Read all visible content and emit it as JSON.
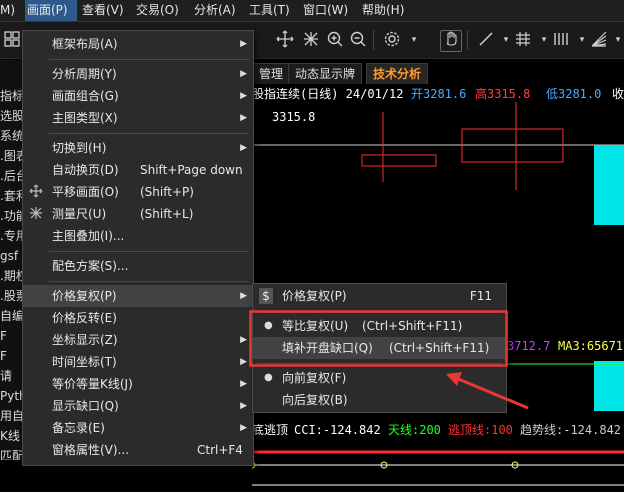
{
  "menubar": {
    "items": [
      {
        "label": "M)",
        "active": false
      },
      {
        "label": "画面(P)",
        "active": true
      },
      {
        "label": "查看(V)",
        "active": false
      },
      {
        "label": "交易(O)",
        "active": false
      },
      {
        "label": "分析(A)",
        "active": false
      },
      {
        "label": "工具(T)",
        "active": false
      },
      {
        "label": "窗口(W)",
        "active": false
      },
      {
        "label": "帮助(H)",
        "active": false
      }
    ]
  },
  "toolbar": {
    "icons": [
      "grid-icon",
      "move-icon",
      "crosshair-icon",
      "zoom-in-icon",
      "zoom-out-icon",
      "settings-icon",
      "hand-icon",
      "line-icon",
      "grid-draw-icon",
      "bars-icon",
      "fan-icon"
    ]
  },
  "left_panel": {
    "items": [
      "指标",
      "选股",
      "系统",
      ".图表",
      ".后台",
      ".套利",
      ".功能",
      ".专用",
      "gsf",
      ".期权",
      ".股票",
      "自编",
      "F",
      "F",
      "请",
      "Pyth",
      "用自",
      "K线",
      "匹配"
    ]
  },
  "tabs": [
    {
      "label": "管理",
      "active": false
    },
    {
      "label": "动态显示牌",
      "active": false
    },
    {
      "label": "技术分析",
      "active": true
    }
  ],
  "chart": {
    "header_title": "股指连续(日线) 24/01/12",
    "open_label": "开3281.6",
    "high_label": "高3315.8",
    "low_label": "低3281.0",
    "tail_label": "收",
    "price_label": "3315.8",
    "ma_left": "3712.7",
    "ma3_label": "MA3:65671",
    "indicator_prefix": "底逃顶",
    "cci_label": "CCI:-124.842",
    "sky_label": "天线:200",
    "escape_label": "逃顶线:100",
    "trend_label": "趋势线:-124.842",
    "colors": {
      "open": "#4aa8ff",
      "high": "#ff4040",
      "low": "#4aa8ff",
      "cyan_candle": "#00e5e5",
      "red_candle": "#ff2a2a",
      "indicator_white": "#ffffff",
      "indicator_green": "#22ff22",
      "indicator_red": "#ff3030"
    }
  },
  "main_menu": {
    "items": [
      {
        "label": "框架布局(A)",
        "shortcut": "",
        "submenu": true,
        "icon": ""
      },
      {
        "label": "分析周期(Y)",
        "shortcut": "",
        "submenu": true,
        "icon": ""
      },
      {
        "label": "画面组合(G)",
        "shortcut": "",
        "submenu": true,
        "icon": ""
      },
      {
        "label": "主图类型(X)",
        "shortcut": "",
        "submenu": true,
        "icon": ""
      },
      {
        "label": "切换到(H)",
        "shortcut": "",
        "submenu": true,
        "icon": ""
      },
      {
        "label": "自动换页(D)",
        "shortcut": "Shift+Page down",
        "submenu": false,
        "icon": ""
      },
      {
        "label": "平移画面(O)",
        "shortcut": "(Shift+P)",
        "submenu": false,
        "icon": "move-icon"
      },
      {
        "label": "测量尺(U)",
        "shortcut": "(Shift+L)",
        "submenu": false,
        "icon": "ruler-icon"
      },
      {
        "label": "主图叠加(I)...",
        "shortcut": "",
        "submenu": false,
        "icon": ""
      },
      {
        "label": "配色方案(S)...",
        "shortcut": "",
        "submenu": false,
        "icon": ""
      },
      {
        "label": "价格复权(P)",
        "shortcut": "",
        "submenu": true,
        "icon": ""
      },
      {
        "label": "价格反转(E)",
        "shortcut": "",
        "submenu": false,
        "icon": ""
      },
      {
        "label": "坐标显示(Z)",
        "shortcut": "",
        "submenu": true,
        "icon": ""
      },
      {
        "label": "时间坐标(T)",
        "shortcut": "",
        "submenu": true,
        "icon": ""
      },
      {
        "label": "等价等量K线(J)",
        "shortcut": "",
        "submenu": true,
        "icon": ""
      },
      {
        "label": "显示缺口(Q)",
        "shortcut": "",
        "submenu": true,
        "icon": ""
      },
      {
        "label": "备忘录(E)",
        "shortcut": "",
        "submenu": true,
        "icon": ""
      },
      {
        "label": "窗格属性(V)...",
        "shortcut": "Ctrl+F4",
        "submenu": false,
        "icon": ""
      }
    ]
  },
  "sub_menu": {
    "header": {
      "label": "价格复权(P)",
      "shortcut": "F11",
      "icon": "dollar-icon"
    },
    "items": [
      {
        "label": "等比复权(U)",
        "shortcut": "(Ctrl+Shift+F11)",
        "bullet": true
      },
      {
        "label": "填补开盘缺口(Q)",
        "shortcut": "(Ctrl+Shift+F11)",
        "bullet": false
      },
      {
        "label": "向前复权(F)",
        "shortcut": "",
        "bullet": true
      },
      {
        "label": "向后复权(B)",
        "shortcut": "",
        "bullet": false
      }
    ]
  }
}
